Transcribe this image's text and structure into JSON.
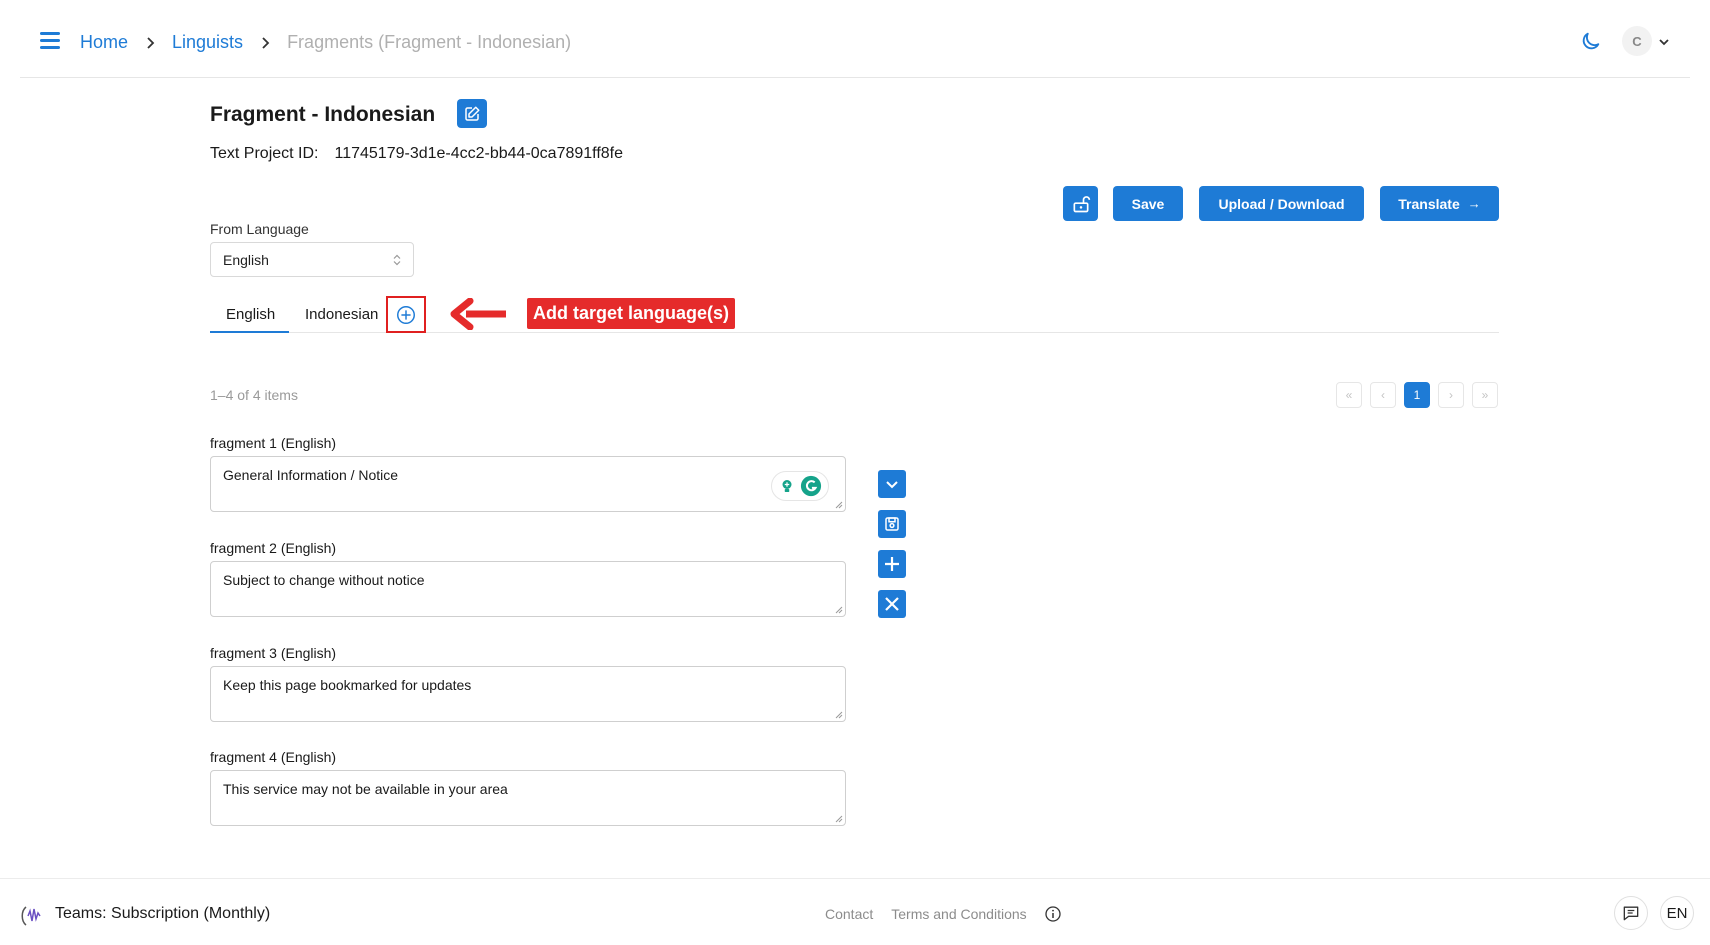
{
  "header": {
    "breadcrumbs": {
      "home": "Home",
      "linguists": "Linguists",
      "current": "Fragments (Fragment - Indonesian)"
    },
    "avatar_initial": "C"
  },
  "page": {
    "title": "Fragment - Indonesian",
    "project_id_label": "Text Project ID:",
    "project_id_value": "11745179-3d1e-4cc2-bb44-0ca7891ff8fe"
  },
  "toolbar": {
    "save_label": "Save",
    "upload_download_label": "Upload / Download",
    "translate_label": "Translate",
    "translate_arrow": "→"
  },
  "from_language": {
    "label": "From Language",
    "selected": "English"
  },
  "tabs": [
    {
      "label": "English",
      "active": true
    },
    {
      "label": "Indonesian",
      "active": false
    }
  ],
  "annotation": {
    "label": "Add  target language(s)"
  },
  "list": {
    "count_text": "1–4 of 4 items",
    "pagination": {
      "first": "«",
      "prev": "‹",
      "current": "1",
      "next": "›",
      "last": "»"
    }
  },
  "fragments": [
    {
      "label": "fragment 1 (English)",
      "value": "General Information / Notice"
    },
    {
      "label": "fragment 2 (English)",
      "value": "Subject to change without notice"
    },
    {
      "label": "fragment 3 (English)",
      "value": "Keep this page bookmarked for updates"
    },
    {
      "label": "fragment 4 (English)",
      "value": "This service may not be available in your area"
    }
  ],
  "footer": {
    "plan": "Teams: Subscription (Monthly)",
    "contact": "Contact",
    "terms": "Terms and Conditions",
    "language": "EN"
  },
  "colors": {
    "accent": "#1e7bd6",
    "annotation": "#e52b2b"
  },
  "icons": [
    "hamburger-icon",
    "chevron-right-icon",
    "moon-icon",
    "chevron-down-icon",
    "edit-icon",
    "unlock-icon",
    "plus-circle-icon",
    "chevron-down-square-icon",
    "save-icon",
    "plus-icon",
    "close-icon",
    "grammarly-icon",
    "info-icon",
    "chat-icon",
    "logo-icon"
  ]
}
